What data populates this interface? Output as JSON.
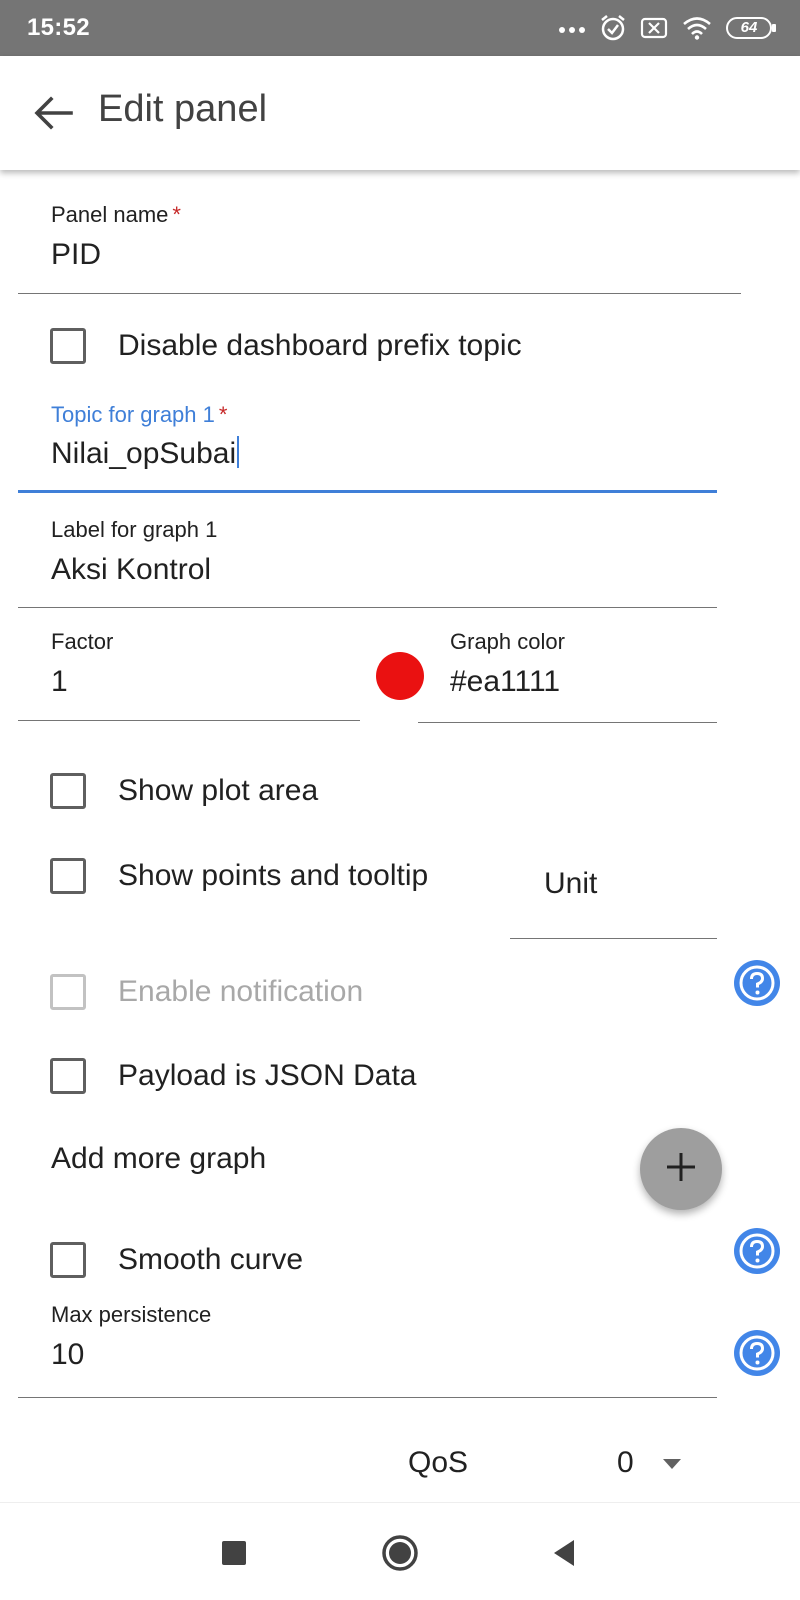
{
  "status_bar": {
    "time": "15:52",
    "icons": [
      "more-dots-icon",
      "alarm-icon",
      "no-sim-icon",
      "wifi-icon",
      "battery-icon"
    ],
    "battery": "64"
  },
  "app_bar": {
    "back_icon": "arrow-back-icon",
    "title": "Edit panel"
  },
  "form": {
    "panel_name": {
      "label": "Panel name",
      "required": "*",
      "value": "PID"
    },
    "disable_prefix": {
      "label": "Disable dashboard prefix topic",
      "checked": false
    },
    "topic_graph1": {
      "label": "Topic for graph 1",
      "required": "*",
      "value": "Nilai_opSubai"
    },
    "label_graph1": {
      "label": "Label for graph 1",
      "value": "Aksi Kontrol"
    },
    "factor": {
      "label": "Factor",
      "value": "1"
    },
    "graph_color": {
      "label": "Graph color",
      "value": "#ea1111",
      "swatch": "#ea1111"
    },
    "show_plot_area": {
      "label": "Show plot area",
      "checked": false
    },
    "show_points": {
      "label": "Show points and tooltip",
      "checked": false
    },
    "unit": {
      "placeholder": "Unit",
      "value": ""
    },
    "enable_notification": {
      "label": "Enable notification",
      "checked": false,
      "disabled": true
    },
    "payload_json": {
      "label": "Payload is JSON Data",
      "checked": false
    },
    "add_more_graph": "Add more graph",
    "smooth_curve": {
      "label": "Smooth curve",
      "checked": false
    },
    "max_persistence": {
      "label": "Max persistence",
      "value": "10"
    },
    "qos": {
      "label": "QoS",
      "value": "0"
    }
  },
  "fab_icon": "plus-icon",
  "help_icon": "help-circle-icon",
  "colors": {
    "accent": "#3f7fd8",
    "help_blue": "#4286e8",
    "status_bar": "#757575",
    "fab": "#9e9e9e",
    "required": "#c62828"
  },
  "nav_bar": [
    "recents-square-icon",
    "home-circle-icon",
    "back-triangle-icon"
  ]
}
